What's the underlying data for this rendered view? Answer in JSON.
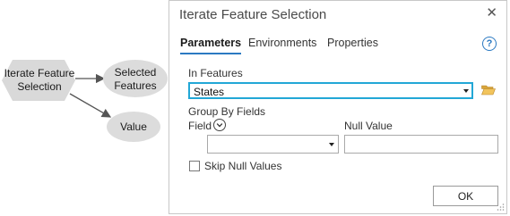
{
  "diagram": {
    "tool_label": "Iterate Feature Selection",
    "tool_label_line1": "Iterate Feature",
    "tool_label_line2": "Selection",
    "output1_line1": "Selected",
    "output1_line2": "Features",
    "output2_label": "Value",
    "colors": {
      "tool_fill": "#d9d9d9",
      "node_fill": "#dcdcdc",
      "arrow": "#555555"
    }
  },
  "dialog": {
    "title": "Iterate Feature Selection",
    "close_icon": "close-icon",
    "help_icon_glyph": "?",
    "tabs": [
      {
        "label": "Parameters",
        "active": true
      },
      {
        "label": "Environments",
        "active": false
      },
      {
        "label": "Properties",
        "active": false
      }
    ],
    "in_features": {
      "label": "In Features",
      "value": "States"
    },
    "group_by": {
      "label": "Group By Fields",
      "field_label": "Field",
      "field_value": ""
    },
    "null_value": {
      "label": "Null Value",
      "value": ""
    },
    "skip_null": {
      "label": "Skip Null Values",
      "checked": false
    },
    "ok_label": "OK",
    "colors": {
      "accent": "#2b79c2",
      "focus_border": "#22a7d6",
      "folder": "#e8b84a"
    }
  }
}
